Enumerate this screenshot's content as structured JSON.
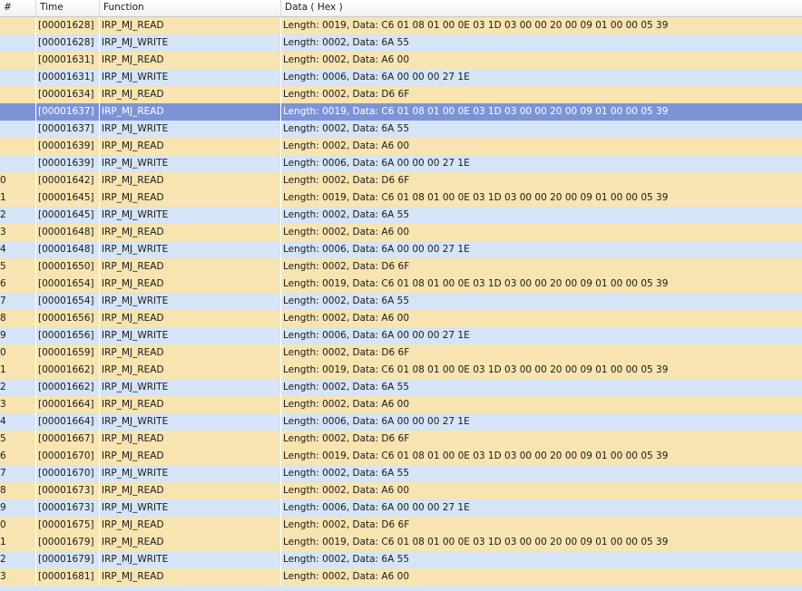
{
  "columns": [
    "#",
    "Time",
    "Function",
    "Data ( Hex )"
  ],
  "rows": [
    {
      "num": "",
      "time": "[00001628]",
      "function": "IRP_MJ_READ",
      "data": "Length: 0019, Data: C6 01 08 01 00 0E 03 1D 03 00 00 20 00 09 01 00 00 05 39",
      "type": "read"
    },
    {
      "num": "",
      "time": "[00001628]",
      "function": "IRP_MJ_WRITE",
      "data": "Length: 0002, Data: 6A 55",
      "type": "write"
    },
    {
      "num": "",
      "time": "[00001631]",
      "function": "IRP_MJ_READ",
      "data": "Length: 0002, Data: A6 00",
      "type": "read"
    },
    {
      "num": "",
      "time": "[00001631]",
      "function": "IRP_MJ_WRITE",
      "data": "Length: 0006, Data: 6A 00 00 00 27 1E",
      "type": "write"
    },
    {
      "num": "",
      "time": "[00001634]",
      "function": "IRP_MJ_READ",
      "data": "Length: 0002, Data: D6 6F",
      "type": "read"
    },
    {
      "num": "",
      "time": "[00001637]",
      "function": "IRP_MJ_READ",
      "data": "Length: 0019, Data: C6 01 08 01 00 0E 03 1D 03 00 00 20 00 09 01 00 00 05 39",
      "type": "selected"
    },
    {
      "num": "",
      "time": "[00001637]",
      "function": "IRP_MJ_WRITE",
      "data": "Length: 0002, Data: 6A 55",
      "type": "write"
    },
    {
      "num": "",
      "time": "[00001639]",
      "function": "IRP_MJ_READ",
      "data": "Length: 0002, Data: A6 00",
      "type": "read"
    },
    {
      "num": "",
      "time": "[00001639]",
      "function": "IRP_MJ_WRITE",
      "data": "Length: 0006, Data: 6A 00 00 00 27 1E",
      "type": "write"
    },
    {
      "num": "0",
      "time": "[00001642]",
      "function": "IRP_MJ_READ",
      "data": "Length: 0002, Data: D6 6F",
      "type": "read"
    },
    {
      "num": "1",
      "time": "[00001645]",
      "function": "IRP_MJ_READ",
      "data": "Length: 0019, Data: C6 01 08 01 00 0E 03 1D 03 00 00 20 00 09 01 00 00 05 39",
      "type": "read"
    },
    {
      "num": "2",
      "time": "[00001645]",
      "function": "IRP_MJ_WRITE",
      "data": "Length: 0002, Data: 6A 55",
      "type": "write"
    },
    {
      "num": "3",
      "time": "[00001648]",
      "function": "IRP_MJ_READ",
      "data": "Length: 0002, Data: A6 00",
      "type": "read"
    },
    {
      "num": "4",
      "time": "[00001648]",
      "function": "IRP_MJ_WRITE",
      "data": "Length: 0006, Data: 6A 00 00 00 27 1E",
      "type": "write"
    },
    {
      "num": "5",
      "time": "[00001650]",
      "function": "IRP_MJ_READ",
      "data": "Length: 0002, Data: D6 6F",
      "type": "read"
    },
    {
      "num": "6",
      "time": "[00001654]",
      "function": "IRP_MJ_READ",
      "data": "Length: 0019, Data: C6 01 08 01 00 0E 03 1D 03 00 00 20 00 09 01 00 00 05 39",
      "type": "read"
    },
    {
      "num": "7",
      "time": "[00001654]",
      "function": "IRP_MJ_WRITE",
      "data": "Length: 0002, Data: 6A 55",
      "type": "write"
    },
    {
      "num": "8",
      "time": "[00001656]",
      "function": "IRP_MJ_READ",
      "data": "Length: 0002, Data: A6 00",
      "type": "read"
    },
    {
      "num": "9",
      "time": "[00001656]",
      "function": "IRP_MJ_WRITE",
      "data": "Length: 0006, Data: 6A 00 00 00 27 1E",
      "type": "write"
    },
    {
      "num": "0",
      "time": "[00001659]",
      "function": "IRP_MJ_READ",
      "data": "Length: 0002, Data: D6 6F",
      "type": "read"
    },
    {
      "num": "1",
      "time": "[00001662]",
      "function": "IRP_MJ_READ",
      "data": "Length: 0019, Data: C6 01 08 01 00 0E 03 1D 03 00 00 20 00 09 01 00 00 05 39",
      "type": "read"
    },
    {
      "num": "2",
      "time": "[00001662]",
      "function": "IRP_MJ_WRITE",
      "data": "Length: 0002, Data: 6A 55",
      "type": "write"
    },
    {
      "num": "3",
      "time": "[00001664]",
      "function": "IRP_MJ_READ",
      "data": "Length: 0002, Data: A6 00",
      "type": "read"
    },
    {
      "num": "4",
      "time": "[00001664]",
      "function": "IRP_MJ_WRITE",
      "data": "Length: 0006, Data: 6A 00 00 00 27 1E",
      "type": "write"
    },
    {
      "num": "5",
      "time": "[00001667]",
      "function": "IRP_MJ_READ",
      "data": "Length: 0002, Data: D6 6F",
      "type": "read"
    },
    {
      "num": "6",
      "time": "[00001670]",
      "function": "IRP_MJ_READ",
      "data": "Length: 0019, Data: C6 01 08 01 00 0E 03 1D 03 00 00 20 00 09 01 00 00 05 39",
      "type": "read"
    },
    {
      "num": "7",
      "time": "[00001670]",
      "function": "IRP_MJ_WRITE",
      "data": "Length: 0002, Data: 6A 55",
      "type": "write"
    },
    {
      "num": "8",
      "time": "[00001673]",
      "function": "IRP_MJ_READ",
      "data": "Length: 0002, Data: A6 00",
      "type": "read"
    },
    {
      "num": "9",
      "time": "[00001673]",
      "function": "IRP_MJ_WRITE",
      "data": "Length: 0006, Data: 6A 00 00 00 27 1E",
      "type": "write"
    },
    {
      "num": "0",
      "time": "[00001675]",
      "function": "IRP_MJ_READ",
      "data": "Length: 0002, Data: D6 6F",
      "type": "read"
    },
    {
      "num": "1",
      "time": "[00001679]",
      "function": "IRP_MJ_READ",
      "data": "Length: 0019, Data: C6 01 08 01 00 0E 03 1D 03 00 00 20 00 09 01 00 00 05 39",
      "type": "read"
    },
    {
      "num": "2",
      "time": "[00001679]",
      "function": "IRP_MJ_WRITE",
      "data": "Length: 0002, Data: 6A 55",
      "type": "write"
    },
    {
      "num": "3",
      "time": "[00001681]",
      "function": "IRP_MJ_READ",
      "data": "Length: 0002, Data: A6 00",
      "type": "read"
    }
  ],
  "colors": {
    "read_row": "#f7e4b0",
    "write_row": "#d5e4f6",
    "selected_row": "#7c93d6"
  }
}
